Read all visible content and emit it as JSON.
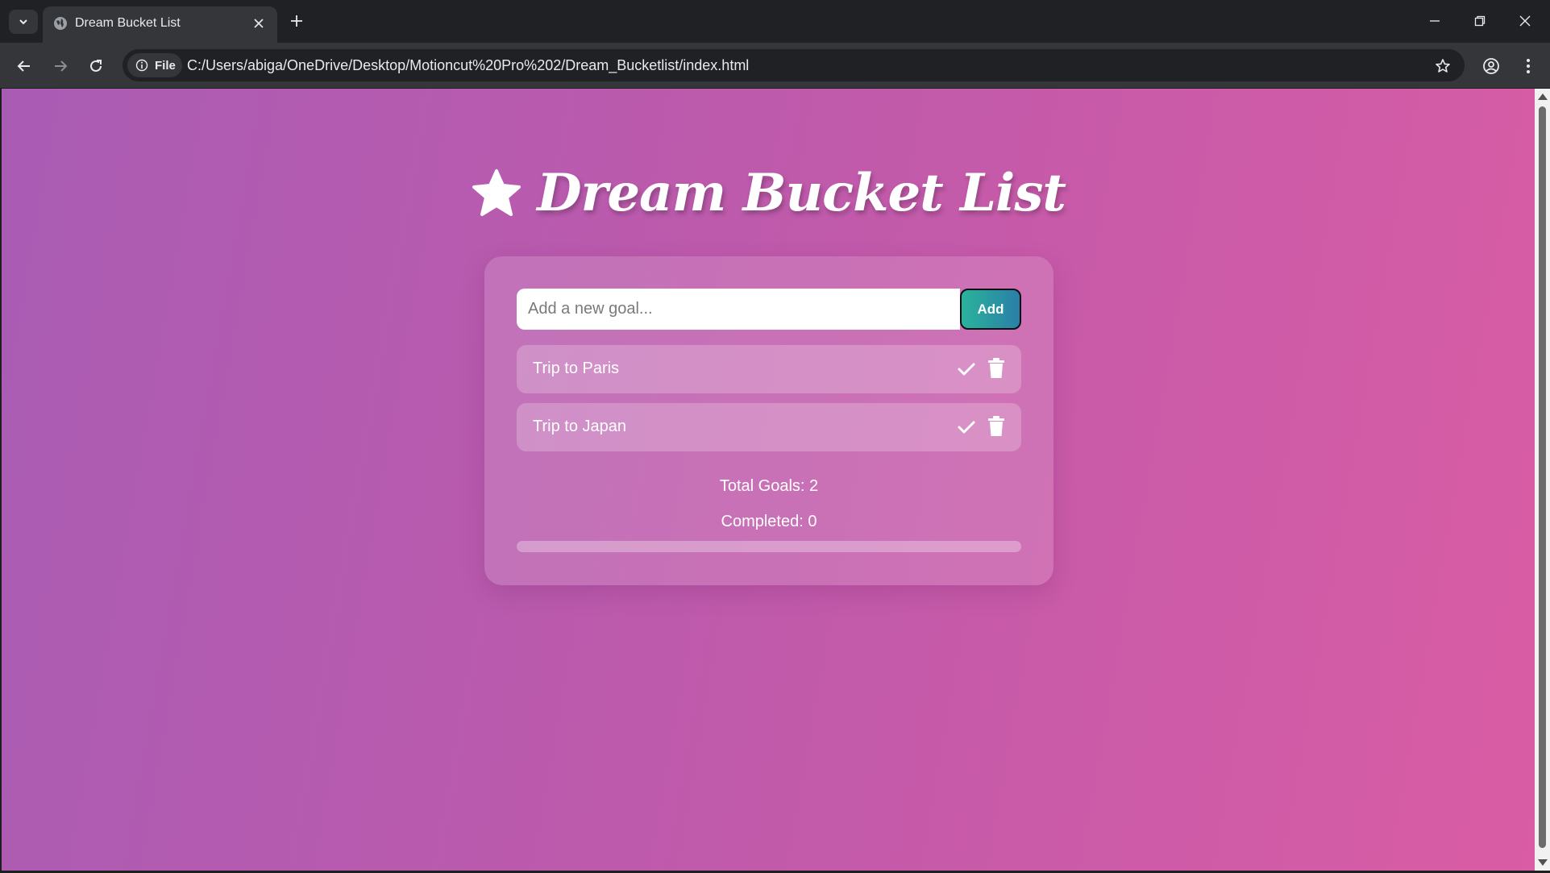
{
  "browser": {
    "tab_title": "Dream Bucket List",
    "site_info_label": "File",
    "url": "C:/Users/abiga/OneDrive/Desktop/Motioncut%20Pro%202/Dream_Bucketlist/index.html"
  },
  "app": {
    "title": "Dream Bucket List",
    "input_placeholder": "Add a new goal...",
    "add_label": "Add",
    "goals": [
      {
        "label": "Trip to Paris",
        "completed": false
      },
      {
        "label": "Trip to Japan",
        "completed": false
      }
    ],
    "total_text": "Total Goals: 2",
    "completed_text": "Completed: 0",
    "progress_fraction": 0
  },
  "colors": {
    "gradient_start": "#a95cb4",
    "gradient_end": "#d95ca4",
    "add_button_start": "#2bb39c",
    "add_button_end": "#2a7fa7"
  }
}
